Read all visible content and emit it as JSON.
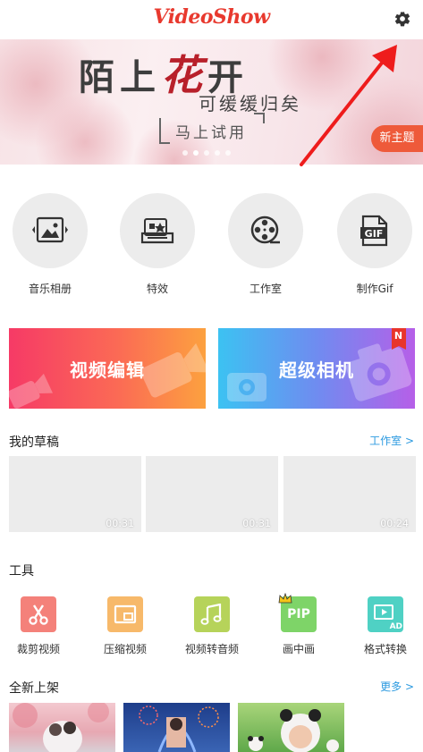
{
  "app": {
    "logo": "VideoShow"
  },
  "header": {
    "settings_icon": "gear-icon"
  },
  "banner": {
    "title_a": "陌上",
    "title_hl": "花",
    "title_b": "开",
    "subtitle": "可缓缓归矣",
    "try_label": "马上试用",
    "badge": "新主题",
    "page_count": 5,
    "active_page": 2
  },
  "quick_actions": [
    {
      "label": "音乐相册",
      "icon": "photo-album-icon"
    },
    {
      "label": "特效",
      "icon": "effects-icon"
    },
    {
      "label": "工作室",
      "icon": "film-reel-icon"
    },
    {
      "label": "制作Gif",
      "icon": "gif-file-icon"
    }
  ],
  "big_buttons": {
    "edit": {
      "label": "视频编辑",
      "icon": "video-camera-icon"
    },
    "camera": {
      "label": "超级相机",
      "icon": "camera-icon",
      "badge": "N"
    }
  },
  "drafts": {
    "title": "我的草稿",
    "more": "工作室 >",
    "items": [
      {
        "duration": "00:31"
      },
      {
        "duration": "00:31"
      },
      {
        "duration": "00:24"
      }
    ]
  },
  "tools": {
    "title": "工具",
    "items": [
      {
        "label": "裁剪视频",
        "icon": "scissors-icon",
        "color": "#f4817a"
      },
      {
        "label": "压缩视频",
        "icon": "compress-icon",
        "color": "#f7b96a"
      },
      {
        "label": "视频转音频",
        "icon": "music-note-icon",
        "color": "#b6d35a"
      },
      {
        "label": "画中画",
        "icon": "pip-icon",
        "color": "#7ed468",
        "text": "PIP"
      },
      {
        "label": "格式转换",
        "icon": "format-convert-icon",
        "color": "#4fd1c4",
        "text": "AD"
      }
    ]
  },
  "new_arrivals": {
    "title": "全新上架",
    "more": "更多 >"
  },
  "colors": {
    "accent_red": "#e8392e",
    "link_blue": "#2c9ae0",
    "badge_orange": "#ee5a3a"
  }
}
